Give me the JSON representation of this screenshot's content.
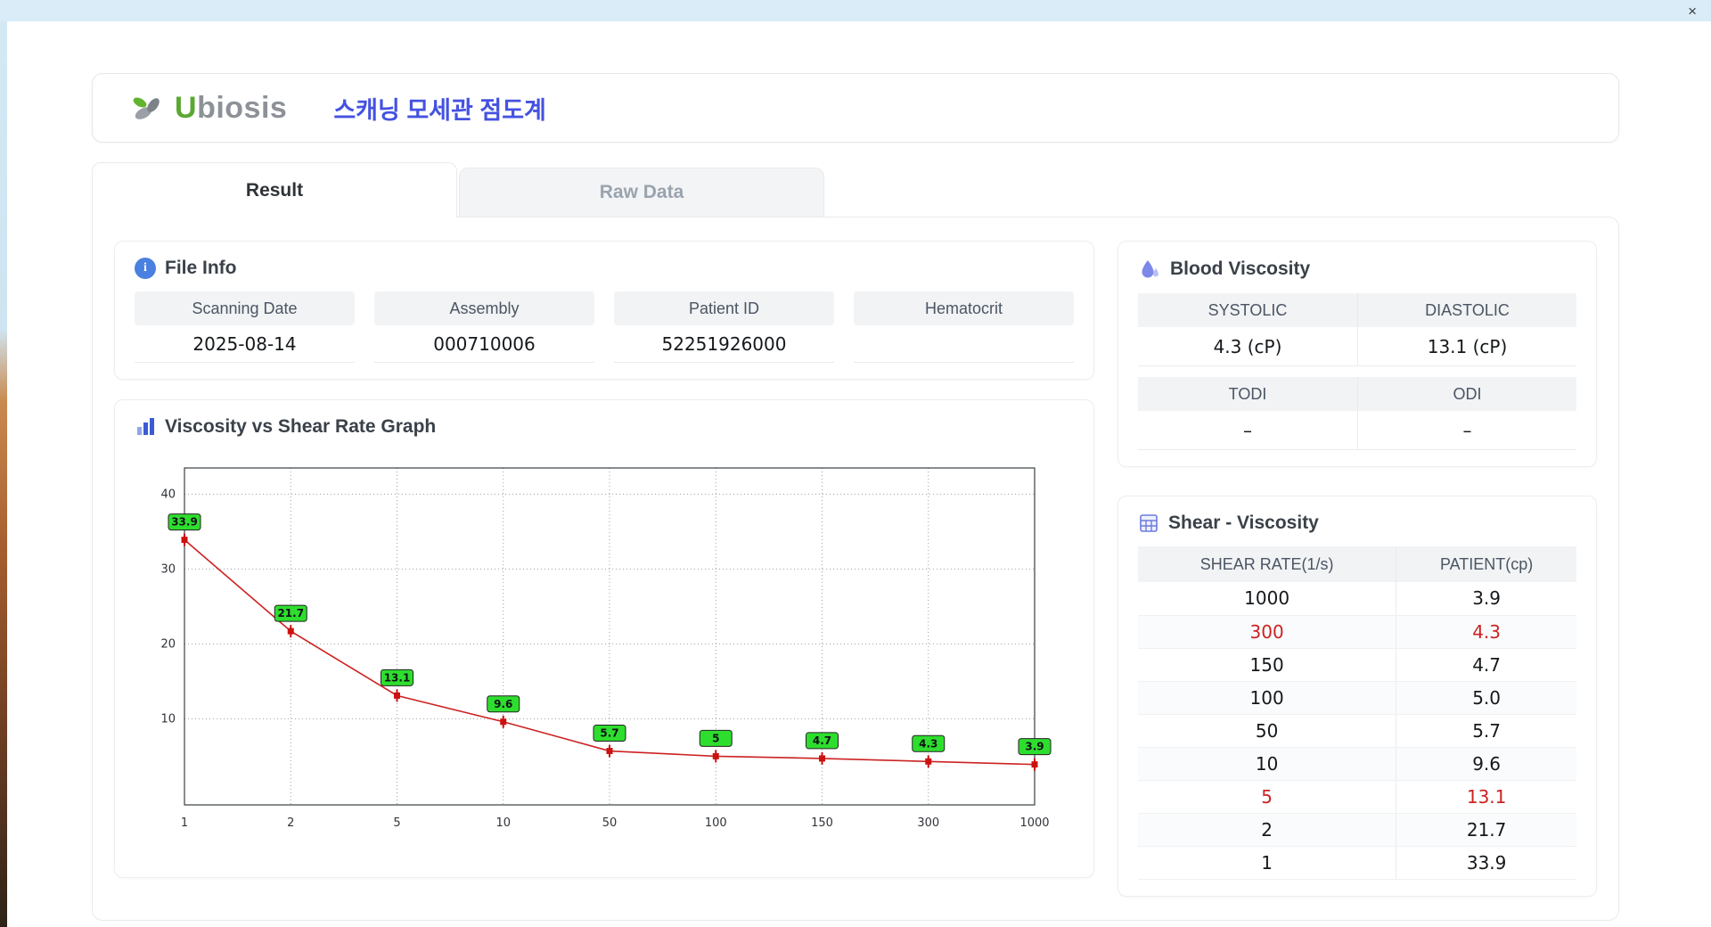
{
  "window": {
    "close_label": "×"
  },
  "header": {
    "brand_u": "U",
    "brand_rest": "biosis",
    "title": "스캐닝 모세관 점도계"
  },
  "tabs": [
    {
      "label": "Result",
      "active": true
    },
    {
      "label": "Raw Data",
      "active": false
    }
  ],
  "file_info": {
    "title": "File Info",
    "fields": [
      {
        "label": "Scanning Date",
        "value": "2025-08-14"
      },
      {
        "label": "Assembly",
        "value": "000710006"
      },
      {
        "label": "Patient ID",
        "value": "52251926000"
      },
      {
        "label": "Hematocrit",
        "value": ""
      }
    ]
  },
  "blood_viscosity": {
    "title": "Blood Viscosity",
    "rows": [
      {
        "headers": [
          "SYSTOLIC",
          "DIASTOLIC"
        ],
        "values": [
          "4.3 (cP)",
          "13.1 (cP)"
        ]
      },
      {
        "headers": [
          "TODI",
          "ODI"
        ],
        "values": [
          "–",
          "–"
        ]
      }
    ]
  },
  "shear_viscosity": {
    "title": "Shear - Viscosity",
    "columns": [
      "SHEAR RATE(1/s)",
      "PATIENT(cp)"
    ],
    "rows": [
      {
        "shear": "1000",
        "patient": "3.9",
        "highlight": false
      },
      {
        "shear": "300",
        "patient": "4.3",
        "highlight": true
      },
      {
        "shear": "150",
        "patient": "4.7",
        "highlight": false
      },
      {
        "shear": "100",
        "patient": "5.0",
        "highlight": false
      },
      {
        "shear": "50",
        "patient": "5.7",
        "highlight": false
      },
      {
        "shear": "10",
        "patient": "9.6",
        "highlight": false
      },
      {
        "shear": "5",
        "patient": "13.1",
        "highlight": true
      },
      {
        "shear": "2",
        "patient": "21.7",
        "highlight": false
      },
      {
        "shear": "1",
        "patient": "33.9",
        "highlight": false
      }
    ]
  },
  "chart_data": {
    "type": "line",
    "title": "Viscosity vs Shear Rate Graph",
    "xlabel": "",
    "ylabel": "",
    "x_categories": [
      "1",
      "2",
      "5",
      "10",
      "50",
      "100",
      "150",
      "300",
      "1000"
    ],
    "values": [
      33.9,
      21.7,
      13.1,
      9.6,
      5.7,
      5,
      4.7,
      4.3,
      3.9
    ],
    "point_labels": [
      "33.9",
      "21.7",
      "13.1",
      "9.6",
      "5.7",
      "5",
      "4.7",
      "4.3",
      "3.9"
    ],
    "y_ticks": [
      10,
      20,
      30,
      40
    ],
    "ylim": [
      -1.5,
      43.5
    ],
    "grid": "dotted",
    "legend": "none",
    "line_color": "#cc2222",
    "marker_color": "#cc1111",
    "label_bg": "#2ede2e"
  },
  "colors": {
    "accent_blue": "#4452e0",
    "brand_green": "#5aa832",
    "header_gray": "#f1f3f5",
    "highlight_red": "#cc2222",
    "topbar_blue": "#d9ecf8"
  }
}
